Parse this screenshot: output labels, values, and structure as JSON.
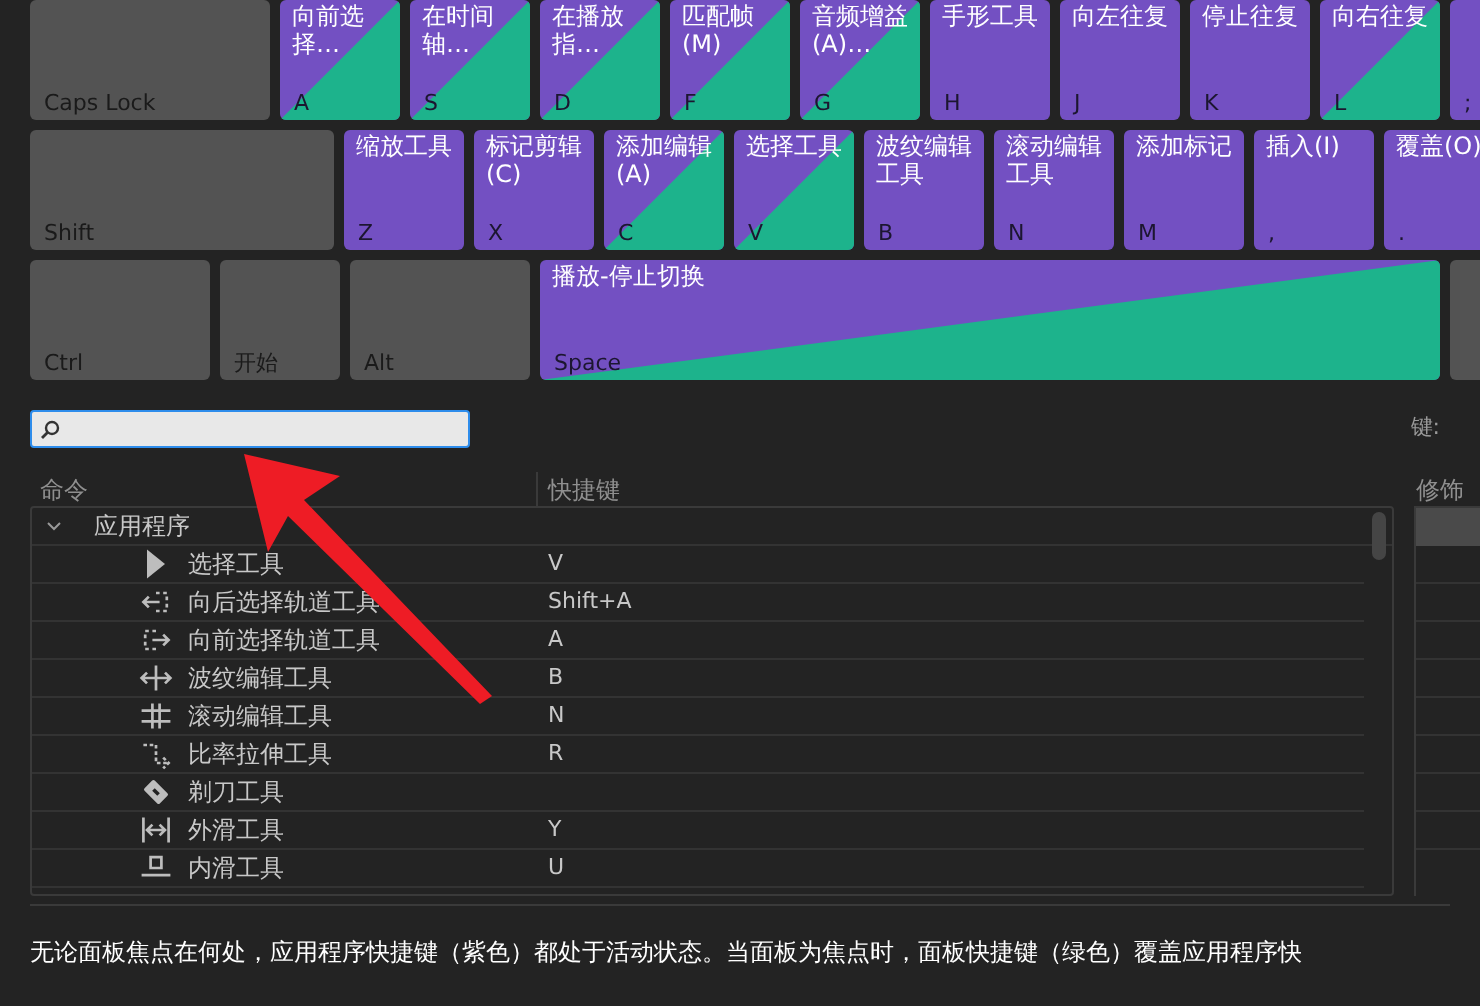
{
  "keyboard": {
    "rows": [
      [
        {
          "key": "Caps Lock",
          "kind": "none"
        },
        {
          "label": "向前选择…",
          "key": "A",
          "kind": "both"
        },
        {
          "label": "在时间轴…",
          "key": "S",
          "kind": "both"
        },
        {
          "label": "在播放指…",
          "key": "D",
          "kind": "both"
        },
        {
          "label": "匹配帧(M)",
          "key": "F",
          "kind": "both"
        },
        {
          "label": "音频增益(A)…",
          "key": "G",
          "kind": "both"
        },
        {
          "label": "手形工具",
          "key": "H",
          "kind": "app"
        },
        {
          "label": "向左往复",
          "key": "J",
          "kind": "app"
        },
        {
          "label": "停止往复",
          "key": "K",
          "kind": "app"
        },
        {
          "label": "向右往复",
          "key": "L",
          "kind": "both"
        },
        {
          "key": ";",
          "kind": "app"
        }
      ],
      [
        {
          "key": "Shift",
          "kind": "none"
        },
        {
          "label": "缩放工具",
          "key": "Z",
          "kind": "app"
        },
        {
          "label": "标记剪辑(C)",
          "key": "X",
          "kind": "app"
        },
        {
          "label": "添加编辑(A)",
          "key": "C",
          "kind": "both"
        },
        {
          "label": "选择工具",
          "key": "V",
          "kind": "both"
        },
        {
          "label": "波纹编辑工具",
          "key": "B",
          "kind": "app"
        },
        {
          "label": "滚动编辑工具",
          "key": "N",
          "kind": "app"
        },
        {
          "label": "添加标记",
          "key": "M",
          "kind": "app"
        },
        {
          "label": "插入(I)",
          "key": ",",
          "kind": "app"
        },
        {
          "label": "覆盖(O)",
          "key": ".",
          "kind": "app"
        }
      ],
      [
        {
          "key": "Ctrl",
          "kind": "none"
        },
        {
          "key": "开始",
          "kind": "none"
        },
        {
          "key": "Alt",
          "kind": "none"
        },
        {
          "label": "播放-停止切换",
          "key": "Space",
          "kind": "both"
        },
        {
          "kind": "none"
        }
      ]
    ]
  },
  "search": {
    "key_label": "键:"
  },
  "table": {
    "columns": [
      "命令",
      "快捷键"
    ],
    "modifier_column": "修饰",
    "groups": [
      {
        "name": "应用程序",
        "expanded": true,
        "children": [
          {
            "name": "选择工具",
            "shortcut": "V"
          },
          {
            "name": "向后选择轨道工具",
            "shortcut": "Shift+A"
          },
          {
            "name": "向前选择轨道工具",
            "shortcut": "A"
          },
          {
            "name": "波纹编辑工具",
            "shortcut": "B"
          },
          {
            "name": "滚动编辑工具",
            "shortcut": "N"
          },
          {
            "name": "比率拉伸工具",
            "shortcut": "R"
          },
          {
            "name": "剃刀工具"
          },
          {
            "name": "外滑工具",
            "shortcut": "Y"
          },
          {
            "name": "内滑工具",
            "shortcut": "U"
          }
        ]
      }
    ]
  },
  "footer": "无论面板焦点在何处，应用程序快捷键（紫色）都处于活动状态。当面板为焦点时，面板快捷键（绿色）覆盖应用程序快"
}
